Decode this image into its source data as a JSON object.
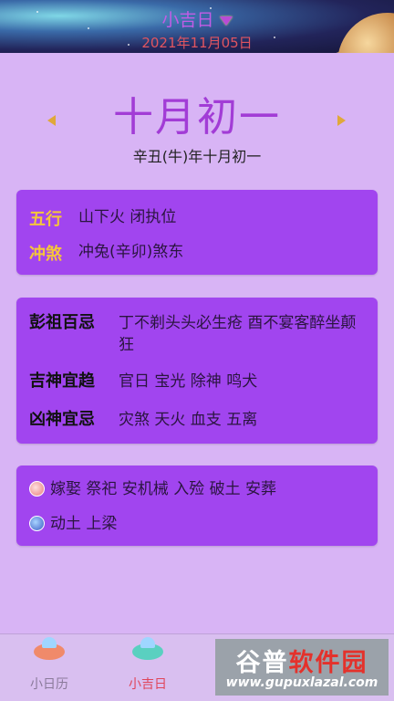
{
  "header": {
    "app_title": "小吉日",
    "date": "2021年11月05日"
  },
  "lunar": {
    "big_date": "十月初一",
    "ganzhi": "辛丑(牛)年十月初一"
  },
  "card1": {
    "rows": [
      {
        "key": "五行",
        "value": "山下火 闭执位"
      },
      {
        "key": "冲煞",
        "value": "冲兔(辛卯)煞东"
      }
    ]
  },
  "card2": {
    "rows": [
      {
        "key": "彭祖百忌",
        "value": "丁不剃头头必生疮 酉不宴客醉坐颠狂"
      },
      {
        "key": "吉神宜趋",
        "value": "官日 宝光 除神 鸣犬"
      },
      {
        "key": "凶神宜忌",
        "value": "灾煞 天火 血支 五离"
      }
    ]
  },
  "card3": {
    "yi": "嫁娶 祭祀 安机械 入殓 破土 安葬",
    "ji": "动土 上梁"
  },
  "tabs": [
    {
      "label": "小日历"
    },
    {
      "label": "小吉日"
    }
  ],
  "watermark": {
    "title_part1": "谷普",
    "title_part2": "软件园",
    "url": "www.gupuxlazal.com"
  },
  "colors": {
    "card_bg": "#a145ef",
    "page_bg": "#d8b4f5",
    "accent_purple": "#a23cd6",
    "key_gold": "#f5c63a",
    "date_red": "#e05560"
  }
}
